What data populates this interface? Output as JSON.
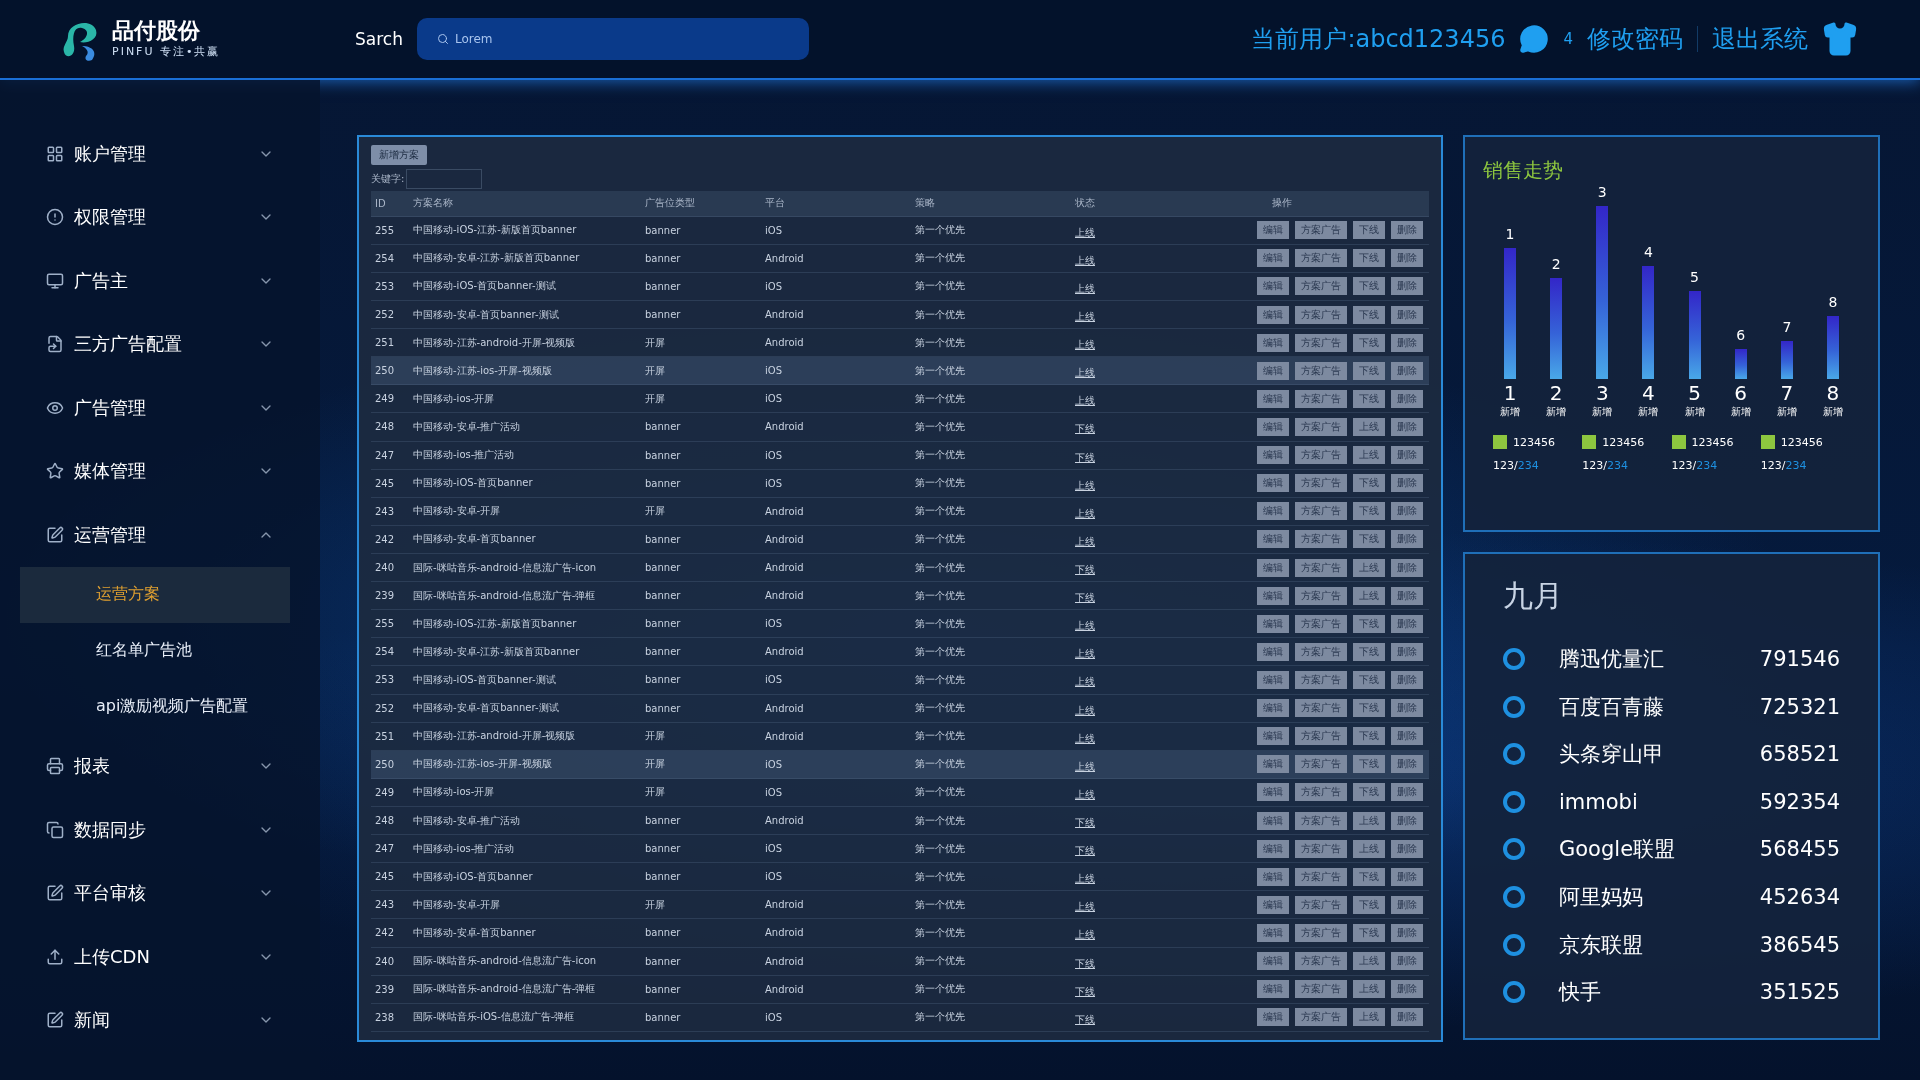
{
  "header": {
    "logo": {
      "name": "品付股份",
      "tagline": "PINFU 专注•共赢"
    },
    "search_label": "Sarch",
    "search": {
      "placeholder": "Lorem"
    },
    "user": "当前用户:abcd123456",
    "messages": "4",
    "change_password": "修改密码",
    "logout": "退出系统"
  },
  "sidebar": {
    "items": [
      {
        "label": "账户管理",
        "expanded": false
      },
      {
        "label": "权限管理",
        "expanded": false
      },
      {
        "label": "广告主",
        "expanded": false
      },
      {
        "label": "三方广告配置",
        "expanded": false
      },
      {
        "label": "广告管理",
        "expanded": false
      },
      {
        "label": "媒体管理",
        "expanded": false
      },
      {
        "label": "运营管理",
        "expanded": true,
        "children": [
          {
            "label": "运营方案",
            "selected": true
          },
          {
            "label": "红名单广告池",
            "selected": false
          },
          {
            "label": "api激励视频广告配置",
            "selected": false
          }
        ]
      },
      {
        "label": "报表",
        "expanded": false
      },
      {
        "label": "数据同步",
        "expanded": false
      },
      {
        "label": "平台审核",
        "expanded": false
      },
      {
        "label": "上传CDN",
        "expanded": false
      },
      {
        "label": "新闻",
        "expanded": false
      }
    ]
  },
  "table": {
    "add_button": "新增方案",
    "filter_label": "关键字:",
    "columns": [
      "ID",
      "方案名称",
      "广告位类型",
      "平台",
      "策略",
      "状态",
      "操作"
    ],
    "rows": [
      {
        "id": "255",
        "name": "中国移动-iOS-江苏-新版首页banner",
        "type": "banner",
        "platform": "iOS",
        "strategy": "第一个优先",
        "status": "上线",
        "actions": [
          "编辑",
          "方案广告",
          "下线",
          "删除"
        ],
        "hovered": false
      },
      {
        "id": "254",
        "name": "中国移动-安卓-江苏-新版首页banner",
        "type": "banner",
        "platform": "Android",
        "strategy": "第一个优先",
        "status": "上线",
        "actions": [
          "编辑",
          "方案广告",
          "下线",
          "删除"
        ],
        "hovered": false
      },
      {
        "id": "253",
        "name": "中国移动-iOS-首页banner-测试",
        "type": "banner",
        "platform": "iOS",
        "strategy": "第一个优先",
        "status": "上线",
        "actions": [
          "编辑",
          "方案广告",
          "下线",
          "删除"
        ],
        "hovered": false
      },
      {
        "id": "252",
        "name": "中国移动-安卓-首页banner-测试",
        "type": "banner",
        "platform": "Android",
        "strategy": "第一个优先",
        "status": "上线",
        "actions": [
          "编辑",
          "方案广告",
          "下线",
          "删除"
        ],
        "hovered": false
      },
      {
        "id": "251",
        "name": "中国移动-江苏-android-开屏-视频版",
        "type": "开屏",
        "platform": "Android",
        "strategy": "第一个优先",
        "status": "上线",
        "actions": [
          "编辑",
          "方案广告",
          "下线",
          "删除"
        ],
        "hovered": false
      },
      {
        "id": "250",
        "name": "中国移动-江苏-ios-开屏-视频版",
        "type": "开屏",
        "platform": "iOS",
        "strategy": "第一个优先",
        "status": "上线",
        "actions": [
          "编辑",
          "方案广告",
          "下线",
          "删除"
        ],
        "hovered": true
      },
      {
        "id": "249",
        "name": "中国移动-ios-开屏",
        "type": "开屏",
        "platform": "iOS",
        "strategy": "第一个优先",
        "status": "上线",
        "actions": [
          "编辑",
          "方案广告",
          "下线",
          "删除"
        ],
        "hovered": false
      },
      {
        "id": "248",
        "name": "中国移动-安卓-推广活动",
        "type": "banner",
        "platform": "Android",
        "strategy": "第一个优先",
        "status": "下线",
        "actions": [
          "编辑",
          "方案广告",
          "上线",
          "删除"
        ],
        "hovered": false
      },
      {
        "id": "247",
        "name": "中国移动-ios-推广活动",
        "type": "banner",
        "platform": "iOS",
        "strategy": "第一个优先",
        "status": "下线",
        "actions": [
          "编辑",
          "方案广告",
          "上线",
          "删除"
        ],
        "hovered": false
      },
      {
        "id": "245",
        "name": "中国移动-iOS-首页banner",
        "type": "banner",
        "platform": "iOS",
        "strategy": "第一个优先",
        "status": "上线",
        "actions": [
          "编辑",
          "方案广告",
          "下线",
          "删除"
        ],
        "hovered": false
      },
      {
        "id": "243",
        "name": "中国移动-安卓-开屏",
        "type": "开屏",
        "platform": "Android",
        "strategy": "第一个优先",
        "status": "上线",
        "actions": [
          "编辑",
          "方案广告",
          "下线",
          "删除"
        ],
        "hovered": false
      },
      {
        "id": "242",
        "name": "中国移动-安卓-首页banner",
        "type": "banner",
        "platform": "Android",
        "strategy": "第一个优先",
        "status": "上线",
        "actions": [
          "编辑",
          "方案广告",
          "下线",
          "删除"
        ],
        "hovered": false
      },
      {
        "id": "240",
        "name": "国际-咪咕音乐-android-信息流广告-icon",
        "type": "banner",
        "platform": "Android",
        "strategy": "第一个优先",
        "status": "下线",
        "actions": [
          "编辑",
          "方案广告",
          "上线",
          "删除"
        ],
        "hovered": false
      },
      {
        "id": "239",
        "name": "国际-咪咕音乐-android-信息流广告-弹框",
        "type": "banner",
        "platform": "Android",
        "strategy": "第一个优先",
        "status": "下线",
        "actions": [
          "编辑",
          "方案广告",
          "上线",
          "删除"
        ],
        "hovered": false
      },
      {
        "id": "255",
        "name": "中国移动-iOS-江苏-新版首页banner",
        "type": "banner",
        "platform": "iOS",
        "strategy": "第一个优先",
        "status": "上线",
        "actions": [
          "编辑",
          "方案广告",
          "下线",
          "删除"
        ],
        "hovered": false
      },
      {
        "id": "254",
        "name": "中国移动-安卓-江苏-新版首页banner",
        "type": "banner",
        "platform": "Android",
        "strategy": "第一个优先",
        "status": "上线",
        "actions": [
          "编辑",
          "方案广告",
          "下线",
          "删除"
        ],
        "hovered": false
      },
      {
        "id": "253",
        "name": "中国移动-iOS-首页banner-测试",
        "type": "banner",
        "platform": "iOS",
        "strategy": "第一个优先",
        "status": "上线",
        "actions": [
          "编辑",
          "方案广告",
          "下线",
          "删除"
        ],
        "hovered": false
      },
      {
        "id": "252",
        "name": "中国移动-安卓-首页banner-测试",
        "type": "banner",
        "platform": "Android",
        "strategy": "第一个优先",
        "status": "上线",
        "actions": [
          "编辑",
          "方案广告",
          "下线",
          "删除"
        ],
        "hovered": false
      },
      {
        "id": "251",
        "name": "中国移动-江苏-android-开屏-视频版",
        "type": "开屏",
        "platform": "Android",
        "strategy": "第一个优先",
        "status": "上线",
        "actions": [
          "编辑",
          "方案广告",
          "下线",
          "删除"
        ],
        "hovered": false
      },
      {
        "id": "250",
        "name": "中国移动-江苏-ios-开屏-视频版",
        "type": "开屏",
        "platform": "iOS",
        "strategy": "第一个优先",
        "status": "上线",
        "actions": [
          "编辑",
          "方案广告",
          "下线",
          "删除"
        ],
        "hovered": true
      },
      {
        "id": "249",
        "name": "中国移动-ios-开屏",
        "type": "开屏",
        "platform": "iOS",
        "strategy": "第一个优先",
        "status": "上线",
        "actions": [
          "编辑",
          "方案广告",
          "下线",
          "删除"
        ],
        "hovered": false
      },
      {
        "id": "248",
        "name": "中国移动-安卓-推广活动",
        "type": "banner",
        "platform": "Android",
        "strategy": "第一个优先",
        "status": "下线",
        "actions": [
          "编辑",
          "方案广告",
          "上线",
          "删除"
        ],
        "hovered": false
      },
      {
        "id": "247",
        "name": "中国移动-ios-推广活动",
        "type": "banner",
        "platform": "iOS",
        "strategy": "第一个优先",
        "status": "下线",
        "actions": [
          "编辑",
          "方案广告",
          "上线",
          "删除"
        ],
        "hovered": false
      },
      {
        "id": "245",
        "name": "中国移动-iOS-首页banner",
        "type": "banner",
        "platform": "iOS",
        "strategy": "第一个优先",
        "status": "上线",
        "actions": [
          "编辑",
          "方案广告",
          "下线",
          "删除"
        ],
        "hovered": false
      },
      {
        "id": "243",
        "name": "中国移动-安卓-开屏",
        "type": "开屏",
        "platform": "Android",
        "strategy": "第一个优先",
        "status": "上线",
        "actions": [
          "编辑",
          "方案广告",
          "下线",
          "删除"
        ],
        "hovered": false
      },
      {
        "id": "242",
        "name": "中国移动-安卓-首页banner",
        "type": "banner",
        "platform": "Android",
        "strategy": "第一个优先",
        "status": "上线",
        "actions": [
          "编辑",
          "方案广告",
          "下线",
          "删除"
        ],
        "hovered": false
      },
      {
        "id": "240",
        "name": "国际-咪咕音乐-android-信息流广告-icon",
        "type": "banner",
        "platform": "Android",
        "strategy": "第一个优先",
        "status": "下线",
        "actions": [
          "编辑",
          "方案广告",
          "上线",
          "删除"
        ],
        "hovered": false
      },
      {
        "id": "239",
        "name": "国际-咪咕音乐-android-信息流广告-弹框",
        "type": "banner",
        "platform": "Android",
        "strategy": "第一个优先",
        "status": "下线",
        "actions": [
          "编辑",
          "方案广告",
          "上线",
          "删除"
        ],
        "hovered": false
      },
      {
        "id": "238",
        "name": "国际-咪咕音乐-iOS-信息流广告-弹框",
        "type": "banner",
        "platform": "iOS",
        "strategy": "第一个优先",
        "status": "下线",
        "actions": [
          "编辑",
          "方案广告",
          "上线",
          "删除"
        ],
        "hovered": false
      }
    ]
  },
  "sales_trend": {
    "title": "销售走势",
    "bars": [
      {
        "top_label": "1",
        "number": "1",
        "caption": "新增"
      },
      {
        "top_label": "2",
        "number": "2",
        "caption": "新增"
      },
      {
        "top_label": "3",
        "number": "3",
        "caption": "新增"
      },
      {
        "top_label": "4",
        "number": "4",
        "caption": "新增"
      },
      {
        "top_label": "5",
        "number": "5",
        "caption": "新增"
      },
      {
        "top_label": "6",
        "number": "6",
        "caption": "新增"
      },
      {
        "top_label": "7",
        "number": "7",
        "caption": "新增"
      },
      {
        "top_label": "8",
        "number": "8",
        "caption": "新增"
      }
    ],
    "legend": [
      {
        "value": "123456",
        "ratio": "123/",
        "total": "234",
        "color": "#8dc63f"
      },
      {
        "value": "123456",
        "ratio": "123/",
        "total": "234",
        "color": "#8dc63f"
      },
      {
        "value": "123456",
        "ratio": "123/",
        "total": "234",
        "color": "#8dc63f"
      },
      {
        "value": "123456",
        "ratio": "123/",
        "total": "234",
        "color": "#8dc63f"
      }
    ]
  },
  "ranking": {
    "title": "九月",
    "items": [
      {
        "name": "腾迅优量汇",
        "value": "791546"
      },
      {
        "name": "百度百青藤",
        "value": "725321"
      },
      {
        "name": "头条穿山甲",
        "value": "658521"
      },
      {
        "name": "immobi",
        "value": "592354"
      },
      {
        "name": "Google联盟",
        "value": "568455"
      },
      {
        "name": "阿里妈妈",
        "value": "452634"
      },
      {
        "name": "京东联盟",
        "value": "386545"
      },
      {
        "name": "快手",
        "value": "351525"
      }
    ]
  }
}
